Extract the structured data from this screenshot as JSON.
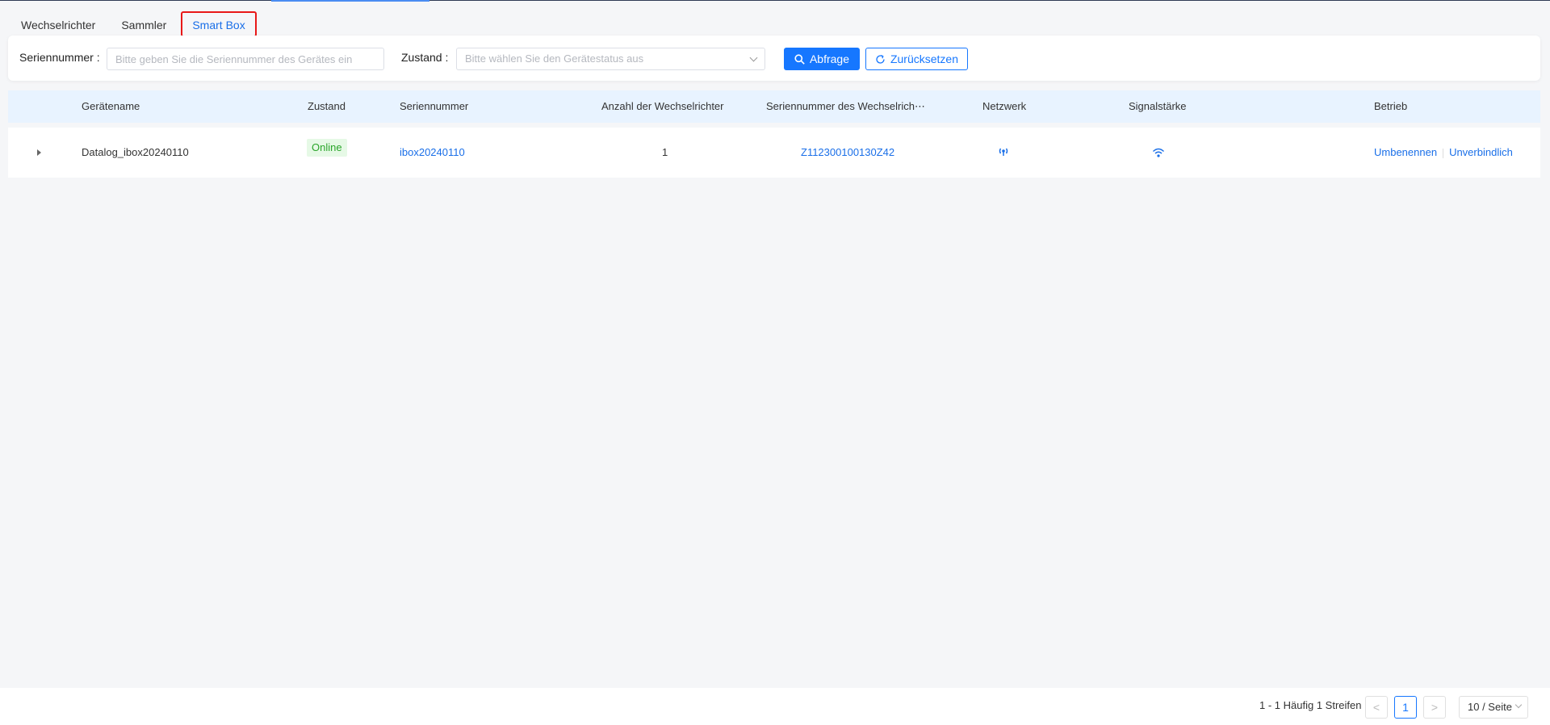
{
  "tabs": [
    {
      "label": "Wechselrichter"
    },
    {
      "label": "Sammler"
    },
    {
      "label": "Smart Box",
      "active": true
    }
  ],
  "filter": {
    "serial_label": "Seriennummer :",
    "serial_placeholder": "Bitte geben Sie die Seriennummer des Gerätes ein",
    "status_label": "Zustand :",
    "status_placeholder": "Bitte wählen Sie den Gerätestatus aus",
    "query_label": "Abfrage",
    "reset_label": "Zurücksetzen"
  },
  "table": {
    "columns": [
      "Gerätename",
      "Zustand",
      "Seriennummer",
      "Anzahl der Wechselrichter",
      "Seriennummer des Wechselrich⋯",
      "Netzwerk",
      "Signalstärke",
      "Betrieb"
    ],
    "rows": [
      {
        "name": "Datalog_ibox20240110",
        "status": "Online",
        "serial": "ibox20240110",
        "inverter_count": "1",
        "inverter_serial": "Z112300100130Z42",
        "network_icon": "network-antenna-icon",
        "signal_icon": "wifi-signal-icon",
        "actions": [
          "Umbenennen",
          "Unverbindlich"
        ]
      }
    ]
  },
  "pagination": {
    "total_text": "1 - 1 Häufig 1 Streifen",
    "prev": "<",
    "current": "1",
    "next": ">",
    "page_size": "10 / Seite"
  },
  "colors": {
    "accent": "#1677ff",
    "online_bg": "#e6f9e6",
    "online_text": "#2aa52a",
    "active_tab_border": "#e81818"
  }
}
